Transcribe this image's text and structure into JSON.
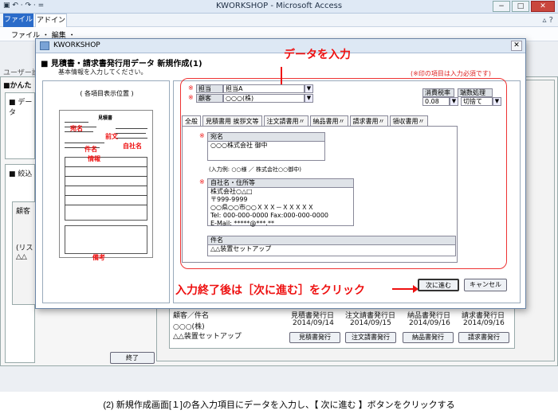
{
  "window": {
    "title": "KWORKSHOP - Microsoft Access",
    "qat": "▣ ↶ · ↷ · ="
  },
  "ribbon": {
    "file_tab": "ファイル",
    "addin_tab": "アドイン",
    "menu": "ファイル ・ 編集 ・"
  },
  "background": {
    "nav_label": "ユーザー設",
    "section_title": "■かんた",
    "data_label": "■ データ",
    "filter_label": "■ 絞込",
    "customer_label": "顧客",
    "list_label": "(リス",
    "customer_short": "△△",
    "table": {
      "col0": "顧客／件名",
      "row_customer": "○○○(株)",
      "row_subject": "△△装置セットアップ",
      "columns": [
        {
          "header": "見積書発行日",
          "date": "2014/09/14",
          "button": "見積書発行"
        },
        {
          "header": "注文請書発行日",
          "date": "2014/09/15",
          "button": "注文請書発行"
        },
        {
          "header": "納品書発行日",
          "date": "2014/09/16",
          "button": "納品書発行"
        },
        {
          "header": "請求書発行日",
          "date": "2014/09/16",
          "button": "請求書発行"
        }
      ]
    },
    "end_button": "終了"
  },
  "dialog": {
    "title": "KWORKSHOP",
    "close": "✕",
    "heading": "■ 見積書・請求書発行用データ 新規作成(1)",
    "subheading": "基本情報を入力してください。",
    "required_note": "(※印の項目は入力必須です)",
    "left_caption": "( 各項目表示位置 )",
    "thumb_labels": {
      "addressee": "宛名",
      "preface": "前文",
      "subject": "件名",
      "sender": "自社名",
      "info": "情報",
      "remarks": "備考",
      "doc_title": "見積書"
    },
    "annotation_top": "データを入力",
    "fields": {
      "tanto_label": "担当",
      "tanto_value": "担当A",
      "customer_label": "顧客",
      "customer_value": "○○○(株)",
      "tax_label": "消費税率",
      "tax_value": "0.08",
      "rounding_label": "端数処理",
      "rounding_value": "切捨て",
      "required_mark": "※"
    },
    "tabs": [
      "全般",
      "見積書用 挨拶文等",
      "注文請書用〃",
      "納品書用〃",
      "請求書用〃",
      "領収書用〃"
    ],
    "addressee": {
      "label": "宛名",
      "value": "○○○株式会社 御中",
      "hint": "(入力例: ○○様 ／ 株式会社○○御中)"
    },
    "sender": {
      "label": "自社名・住所等",
      "lines": [
        "株式会社○△□",
        "〒999-9999",
        "○○県○○市○○ＸＸＸ－ＸＸＸＸＸ",
        "Tel: 000-000-0000  Fax:000-000-0000",
        "E-Mail: *****@***.**"
      ]
    },
    "subject": {
      "label": "件名",
      "value": "△△装置セットアップ"
    },
    "annotation_bottom": "入力終了後は［次に進む］をクリック",
    "next_button": "次に進む",
    "cancel_button": "キャンセル"
  },
  "caption": "(2) 新規作成画面[１]の各入力項目にデータを入力し、【 次に進む 】ボタンをクリックする",
  "colors": {
    "accent_red": "#e11111",
    "file_tab": "#2a6bc9"
  }
}
